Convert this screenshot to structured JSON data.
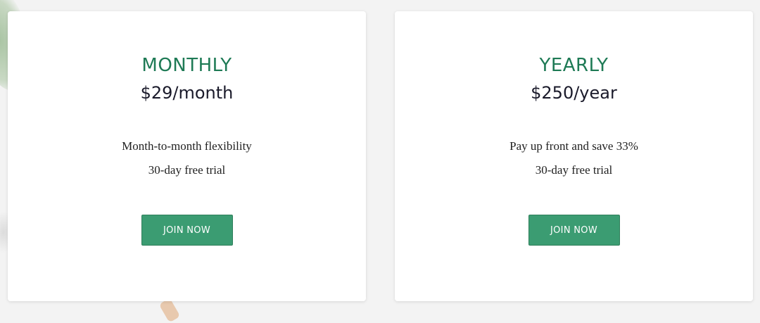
{
  "plans": [
    {
      "name": "MONTHLY",
      "price": "$29/month",
      "features": [
        "Month-to-month flexibility",
        "30-day free trial"
      ],
      "cta": "JOIN NOW"
    },
    {
      "name": "YEARLY",
      "price": "$250/year",
      "features": [
        "Pay up front and save 33%",
        "30-day free trial"
      ],
      "cta": "JOIN NOW"
    }
  ],
  "colors": {
    "accent": "#1e7a55",
    "button": "#3b9c72",
    "background": "#f3f3f3"
  }
}
